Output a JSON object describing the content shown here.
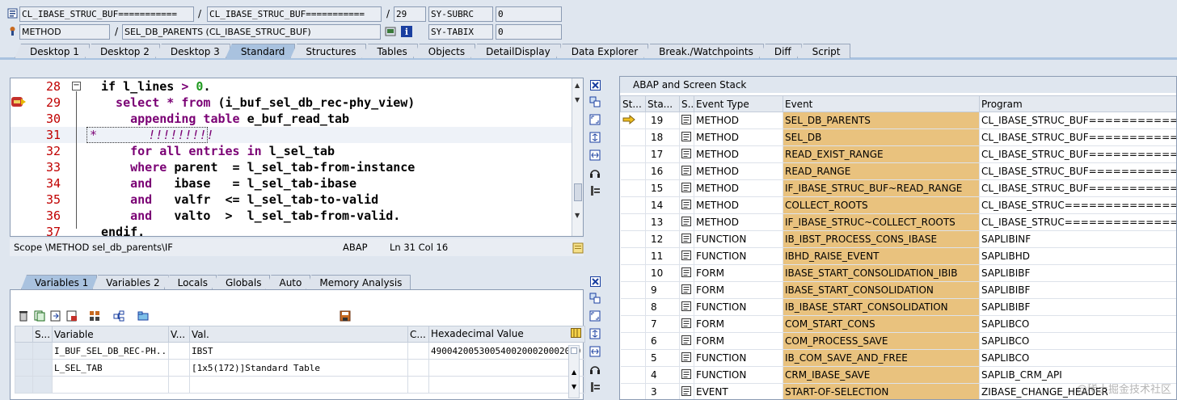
{
  "header": {
    "row1": {
      "program": "CL_IBASE_STRUC_BUF===========",
      "include": "CL_IBASE_STRUC_BUF===========",
      "line": "29",
      "sysvar": "SY-SUBRC",
      "sysval": "0"
    },
    "row2": {
      "event_type": "METHOD",
      "event": "SEL_DB_PARENTS (CL_IBASE_STRUC_BUF)",
      "sysvar": "SY-TABIX",
      "sysval": "0"
    },
    "slash": "/"
  },
  "tabs": [
    "Desktop 1",
    "Desktop 2",
    "Desktop 3",
    "Standard",
    "Structures",
    "Tables",
    "Objects",
    "DetailDisplay",
    "Data Explorer",
    "Break./Watchpoints",
    "Diff",
    "Script"
  ],
  "active_tab": "Standard",
  "editor": {
    "lines": [
      {
        "num": "28",
        "segs": [
          [
            "",
            "if l_lines "
          ],
          [
            "op",
            ">"
          ],
          [
            "",
            " "
          ],
          [
            "num",
            "0"
          ],
          [
            "",
            "."
          ]
        ]
      },
      {
        "num": "29",
        "segs": [
          [
            "kw",
            "  select * from "
          ],
          [
            "",
            "(i_buf_sel_db_rec-phy_view)"
          ]
        ]
      },
      {
        "num": "30",
        "segs": [
          [
            "kw",
            "    appending table "
          ],
          [
            "",
            "e_buf_read_tab"
          ]
        ]
      },
      {
        "num": "31",
        "segs": [
          [
            "cmt",
            "*       !!!!!!!!!"
          ]
        ]
      },
      {
        "num": "32",
        "segs": [
          [
            "kw",
            "    for all entries in "
          ],
          [
            "",
            "l_sel_tab"
          ]
        ]
      },
      {
        "num": "33",
        "segs": [
          [
            "kw",
            "    where "
          ],
          [
            "",
            "parent  = l_sel_tab-from-instance"
          ]
        ]
      },
      {
        "num": "34",
        "segs": [
          [
            "kw",
            "    and   "
          ],
          [
            "",
            "ibase   = l_sel_tab-ibase"
          ]
        ]
      },
      {
        "num": "35",
        "segs": [
          [
            "kw",
            "    and   "
          ],
          [
            "",
            "valfr  <= l_sel_tab-to-valid"
          ]
        ]
      },
      {
        "num": "36",
        "segs": [
          [
            "kw",
            "    and   "
          ],
          [
            "",
            "valto  >  l_sel_tab-from-valid."
          ]
        ]
      },
      {
        "num": "37",
        "segs": [
          [
            "",
            "endif."
          ]
        ]
      }
    ]
  },
  "status": {
    "scope": "Scope \\METHOD sel_db_parents\\IF",
    "lang": "ABAP",
    "pos": "Ln  31 Col  16"
  },
  "var_tabs": [
    "Variables 1",
    "Variables 2",
    "Locals",
    "Globals",
    "Auto",
    "Memory Analysis"
  ],
  "var_table": {
    "headers": [
      "S...",
      "Variable",
      "V...",
      "Val.",
      "C...",
      "Hexadecimal Value"
    ],
    "rows": [
      {
        "var": "I_BUF_SEL_DB_REC-PH...",
        "val": "IBST",
        "hex": "4900420053005400200020002000"
      },
      {
        "var": "L_SEL_TAB",
        "val": "[1x5(172)]Standard Table",
        "hex": ""
      },
      {
        "var": "",
        "val": "",
        "hex": ""
      }
    ]
  },
  "stack": {
    "title": "ABAP and Screen Stack",
    "headers": [
      "St...",
      "Sta...",
      "S...",
      "Event Type",
      "Event",
      "Program"
    ],
    "rows": [
      {
        "level": "19",
        "type": "METHOD",
        "event": "SEL_DB_PARENTS",
        "program": "CL_IBASE_STRUC_BUF===========CI",
        "current": true
      },
      {
        "level": "18",
        "type": "METHOD",
        "event": "SEL_DB",
        "program": "CL_IBASE_STRUC_BUF===========CI"
      },
      {
        "level": "17",
        "type": "METHOD",
        "event": "READ_EXIST_RANGE",
        "program": "CL_IBASE_STRUC_BUF===========CI"
      },
      {
        "level": "16",
        "type": "METHOD",
        "event": "READ_RANGE",
        "program": "CL_IBASE_STRUC_BUF===========CI"
      },
      {
        "level": "15",
        "type": "METHOD",
        "event": "IF_IBASE_STRUC_BUF~READ_RANGE",
        "program": "CL_IBASE_STRUC_BUF===========CI"
      },
      {
        "level": "14",
        "type": "METHOD",
        "event": "COLLECT_ROOTS",
        "program": "CL_IBASE_STRUC===============CI"
      },
      {
        "level": "13",
        "type": "METHOD",
        "event": "IF_IBASE_STRUC~COLLECT_ROOTS",
        "program": "CL_IBASE_STRUC===============CI"
      },
      {
        "level": "12",
        "type": "FUNCTION",
        "event": "IB_IBST_PROCESS_CONS_IBASE",
        "program": "SAPLIBINF"
      },
      {
        "level": "11",
        "type": "FUNCTION",
        "event": "IBHD_RAISE_EVENT",
        "program": "SAPLIBHD"
      },
      {
        "level": "10",
        "type": "FORM",
        "event": "IBASE_START_CONSOLIDATION_IBIB",
        "program": "SAPLIBIBF"
      },
      {
        "level": "9",
        "type": "FORM",
        "event": "IBASE_START_CONSOLIDATION",
        "program": "SAPLIBIBF"
      },
      {
        "level": "8",
        "type": "FUNCTION",
        "event": "IB_IBASE_START_CONSOLIDATION",
        "program": "SAPLIBIBF"
      },
      {
        "level": "7",
        "type": "FORM",
        "event": "COM_START_CONS",
        "program": "SAPLIBCO"
      },
      {
        "level": "6",
        "type": "FORM",
        "event": "COM_PROCESS_SAVE",
        "program": "SAPLIBCO"
      },
      {
        "level": "5",
        "type": "FUNCTION",
        "event": "IB_COM_SAVE_AND_FREE",
        "program": "SAPLIBCO"
      },
      {
        "level": "4",
        "type": "FUNCTION",
        "event": "CRM_IBASE_SAVE",
        "program": "SAPLIB_CRM_API"
      },
      {
        "level": "3",
        "type": "EVENT",
        "event": "START-OF-SELECTION",
        "program": "ZIBASE_CHANGE_HEADER"
      }
    ]
  },
  "watermark": "@稀土掘金技术社区",
  "colors": {
    "keyword": "#7a0074",
    "line_number": "#c00000",
    "event_highlight": "#e9c27e",
    "active_tab": "#a9c2df",
    "background": "#dfe6ef"
  }
}
